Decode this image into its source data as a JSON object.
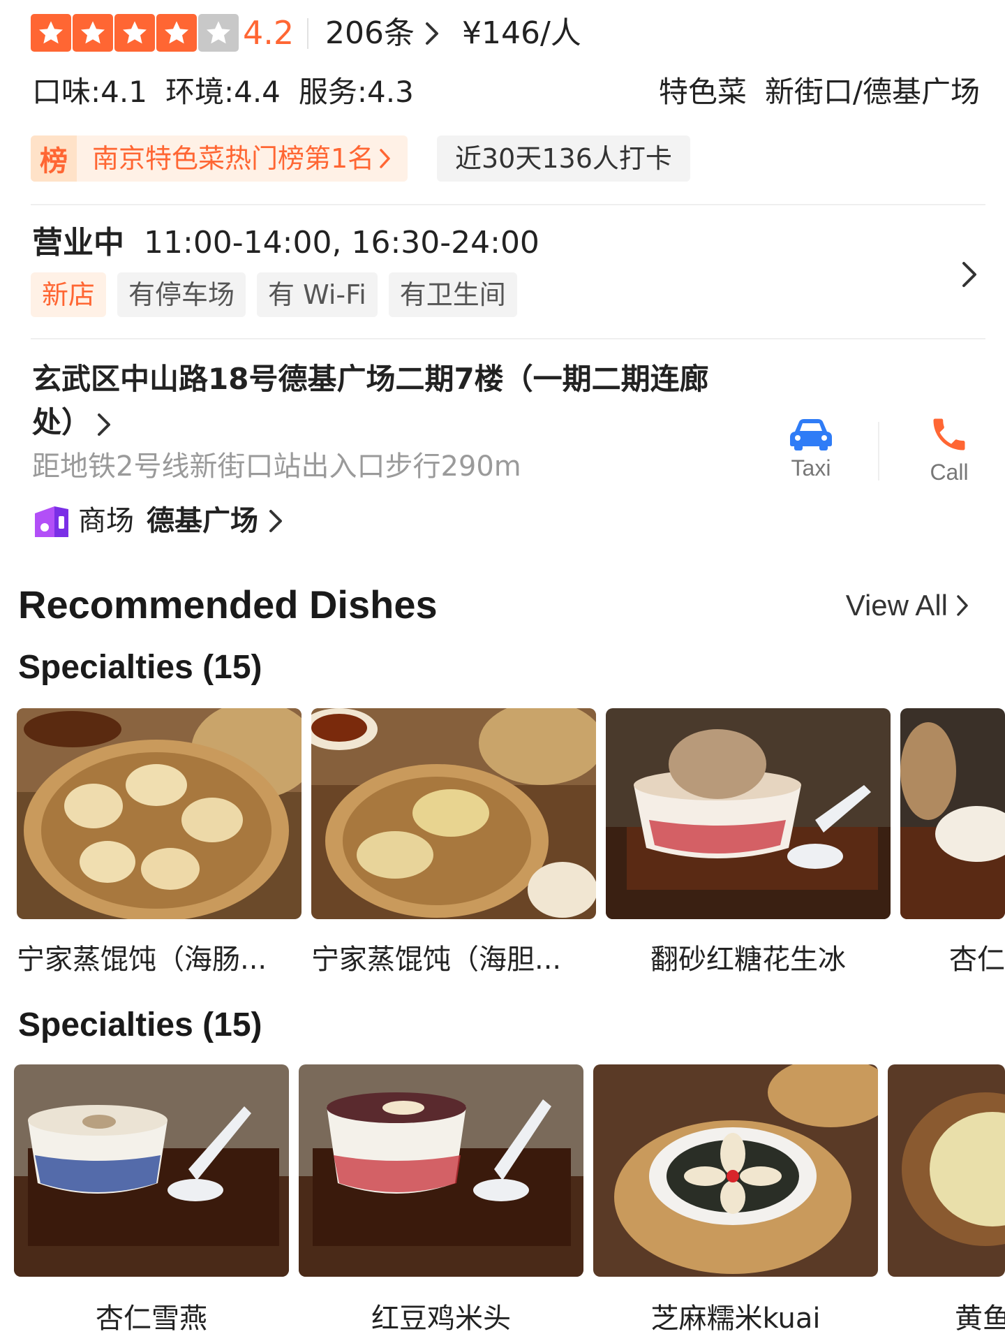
{
  "rating": {
    "score": "4.2",
    "stars_filled": 4,
    "stars_total": 5,
    "review_count": "206条",
    "price": "¥146/人"
  },
  "subscores": {
    "taste": "口味:4.1",
    "environment": "环境:4.4",
    "service": "服务:4.3"
  },
  "category": "特色菜",
  "area": "新街口/德基广场",
  "rank_tag": {
    "icon_char": "榜",
    "text": "南京特色菜热门榜第1名"
  },
  "checkin_tag": "近30天136人打卡",
  "hours": {
    "status": "营业中",
    "times": "11:00-14:00, 16:30-24:00"
  },
  "facilities": [
    "新店",
    "有停车场",
    "有 Wi-Fi",
    "有卫生间"
  ],
  "address": "玄武区中山路18号德基广场二期7楼（一期二期连廊处）",
  "metro_distance": "距地铁2号线新街口站出入口步行290m",
  "mall": {
    "label": "商场",
    "name": "德基广场"
  },
  "actions": {
    "taxi": "Taxi",
    "call": "Call"
  },
  "recommended": {
    "title": "Recommended Dishes",
    "view_all": "View All",
    "groups": [
      {
        "title": "Specialties (15)",
        "dishes": [
          "宁家蒸馄饨（海肠...",
          "宁家蒸馄饨（海胆...",
          "翻砂红糖花生冰",
          "杏仁"
        ]
      },
      {
        "title": "Specialties (15)",
        "dishes": [
          "杏仁雪燕",
          "红豆鸡米头",
          "芝麻糯米kuai",
          "黄鱼"
        ]
      }
    ]
  },
  "colors": {
    "accent": "#ff6633",
    "star_off": "#c8c8c8",
    "taxi_blue": "#2f7cf6",
    "call_orange": "#ff6633",
    "mall_purple": "#8a3ff0"
  }
}
